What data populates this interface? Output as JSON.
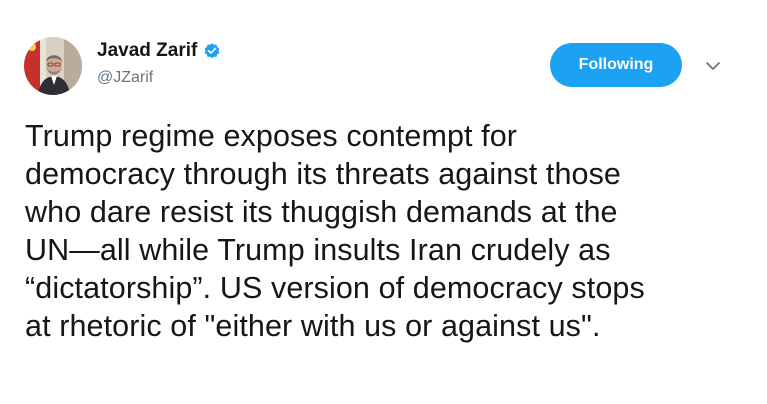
{
  "author": {
    "display_name": "Javad Zarif",
    "handle": "@JZarif",
    "verified": true,
    "avatar_icon": "profile-photo"
  },
  "actions": {
    "follow_label": "Following",
    "menu_icon": "chevron-down-icon"
  },
  "colors": {
    "accent": "#1da1f2",
    "text": "#14171a",
    "muted": "#657786",
    "caret": "#657786"
  },
  "tweet": {
    "text": "Trump regime exposes contempt for\ndemocracy through its threats against those\nwho dare resist its thuggish demands at the\nUN—all while Trump insults Iran crudely as\n“dictatorship”. US version of democracy stops\nat rhetoric of \"either with us or against us\"."
  }
}
